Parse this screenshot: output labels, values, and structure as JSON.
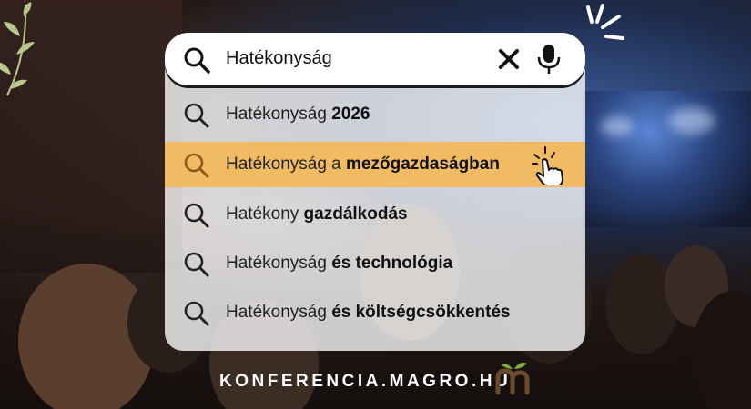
{
  "search": {
    "query": "Hatékonyság"
  },
  "suggestions": [
    {
      "prefix": "Hatékonyság ",
      "bold": "2026",
      "highlighted": false
    },
    {
      "prefix": "Hatékonyság a ",
      "bold": "mezőgazdaságban",
      "highlighted": true
    },
    {
      "prefix": "Hatékony ",
      "bold": "gazdálkodás",
      "highlighted": false
    },
    {
      "prefix": "Hatékonyság ",
      "bold": "és technológia",
      "highlighted": false
    },
    {
      "prefix": "Hatékonyság ",
      "bold": "és költségcsökkentés",
      "highlighted": false
    }
  ],
  "footer": {
    "domain": "KONFERENCIA.MAGRO.HU",
    "logo_text": "m"
  },
  "icons": [
    "search-icon",
    "close-icon",
    "microphone-icon",
    "pointer-hand-icon",
    "leaf-icon",
    "sparkle-rays-icon"
  ],
  "colors": {
    "highlight": "#f1bb63",
    "logo_brown": "#6b4a2e",
    "logo_green": "#7bb040",
    "footer_text": "#ffffff"
  }
}
